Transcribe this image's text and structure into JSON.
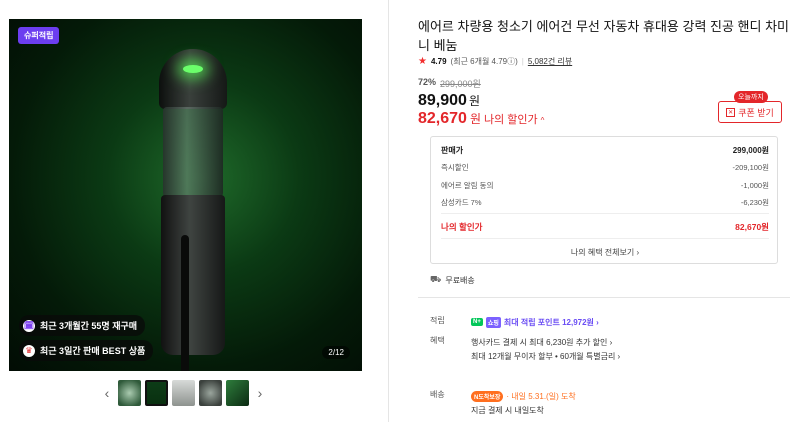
{
  "gallery": {
    "badge": "슈퍼적립",
    "tags": [
      {
        "icon": "🗓",
        "text": "최근 3개월간 55명 재구매"
      },
      {
        "icon": "♛",
        "text": "최근 3일간 판매 BEST 상품"
      }
    ],
    "page_indicator": "2/12",
    "prev_icon": "‹",
    "next_icon": "›"
  },
  "product": {
    "title": "에어르 차량용 청소기 에어건 무선 자동차 휴대용 강력 진공 핸디 차미니 베눔",
    "rating": "4.79",
    "rating_detail": "(최근 6개월 4.79ⓘ)",
    "separator": "|",
    "review_count": "5,082건 리뷰"
  },
  "price": {
    "discount_rate": "72%",
    "original_price": "299,000원",
    "sale_price": "89,900",
    "sale_unit": "원",
    "my_price": "82,670",
    "my_price_unit": "원",
    "my_price_label": "나의 할인가",
    "caret": "^",
    "coupon_tag": "오늘까지",
    "coupon_label": "쿠폰 받기"
  },
  "breakdown": {
    "rows": [
      {
        "label": "판매가",
        "value": "299,000원"
      },
      {
        "label": "즉시할인",
        "value": "-209,100원"
      },
      {
        "label": "에어르 알림 동의",
        "value": "-1,000원"
      },
      {
        "label": "삼성카드 7%",
        "value": "-6,230원"
      }
    ],
    "final": {
      "label": "나의 할인가",
      "value": "82,670원"
    },
    "all_benefits_link": "나의 혜택 전체보기 ›"
  },
  "shipping_free": "무료배송",
  "benefits": {
    "points_label": "적립",
    "npay_badge": "N+",
    "plus_badge": "쇼핑",
    "points_text": "최대 적립 포인트 12,972원 ›",
    "card_label": "혜택",
    "card_lines": [
      "행사카드 결제 시 최대 6,230원 추가 할인 ›",
      "최대 12개월 무이자 할부 • 60개월 특별금리 ›"
    ]
  },
  "delivery": {
    "label": "배송",
    "pill": "N도착보장",
    "arrival": "· 내일 5.31.(일) 도착",
    "subtext": "지금 결제 시 내일도착"
  },
  "colors": {
    "accent_red": "#e3262a",
    "badge_purple": "#6c3ef0",
    "npay_green": "#03c75a"
  }
}
